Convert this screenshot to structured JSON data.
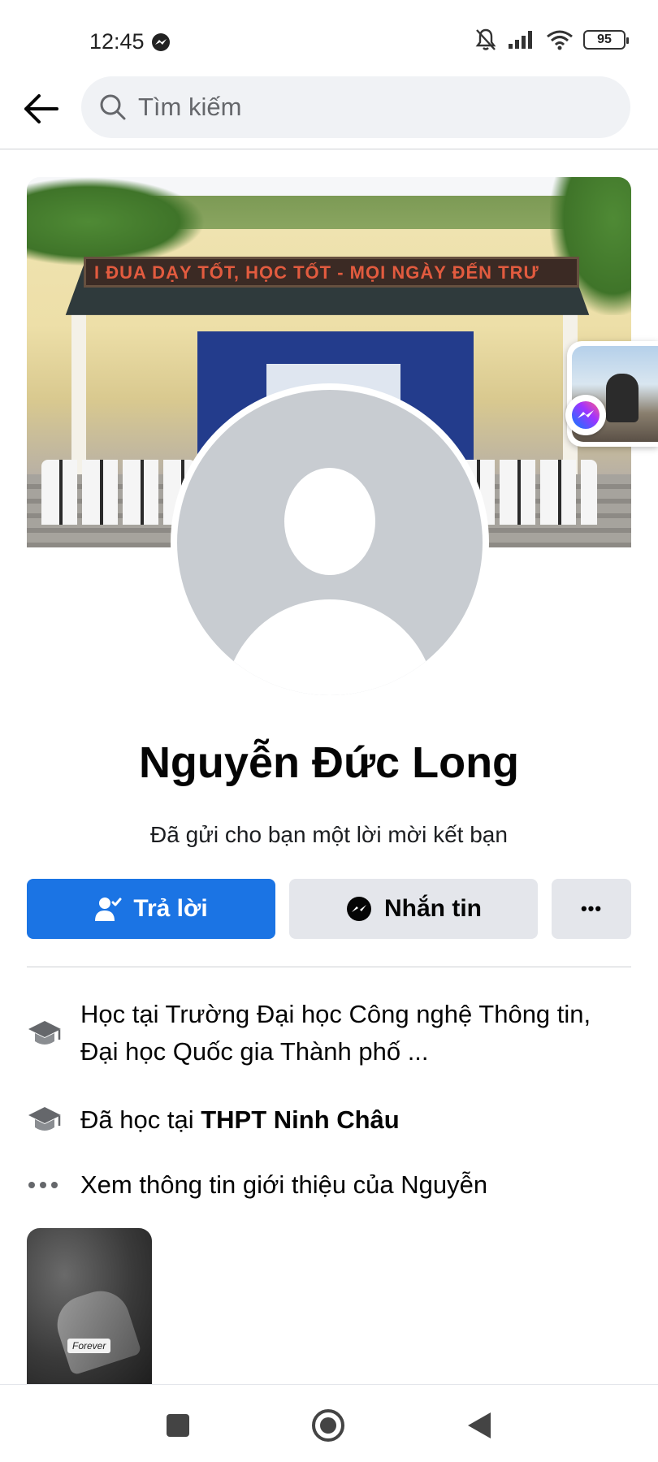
{
  "status_bar": {
    "time": "12:45",
    "battery": "95",
    "icons": [
      "messenger-notification-icon",
      "mute-bell-icon",
      "signal-icon",
      "wifi-icon",
      "battery-icon"
    ]
  },
  "header": {
    "search_placeholder": "Tìm kiếm"
  },
  "cover": {
    "banner_text": "I ĐUA DẠY TỐT, HỌC TỐT  -  MỌI NGÀY ĐẾN TRƯ"
  },
  "profile": {
    "name": "Nguyễn Đức Long",
    "subtitle": "Đã gửi cho bạn một lời mời kết bạn"
  },
  "actions": {
    "reply_label": "Trả lời",
    "message_label": "Nhắn tin",
    "more_label": "•••"
  },
  "info": {
    "studies_at": "Học tại Trường Đại học Công nghệ Thông tin, Đại học Quốc gia Thành phố ...",
    "studied_prefix": "Đã học tại ",
    "studied_school": "THPT Ninh Châu",
    "see_about": "Xem thông tin giới thiệu của Nguyễn"
  },
  "photo": {
    "label": "Forever"
  },
  "colors": {
    "accent": "#1b74e4",
    "secondary_button": "#e4e6eb",
    "text_primary": "#050505",
    "text_secondary": "#65676b"
  }
}
